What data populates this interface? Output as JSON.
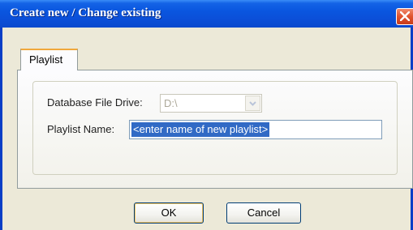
{
  "window": {
    "title": "Create new / Change existing"
  },
  "tabs": [
    {
      "label": "Playlist",
      "selected": true
    }
  ],
  "form": {
    "drive_label": "Database File Drive:",
    "drive_value": "D:\\",
    "name_label": "Playlist Name:",
    "name_value": "<enter name of new playlist>"
  },
  "buttons": {
    "ok_label": "OK",
    "cancel_label": "Cancel"
  },
  "colors": {
    "titlebar": "#0a56df",
    "close_button": "#e0512d",
    "selection": "#316ac5",
    "dialog_background": "#ece9d8"
  },
  "icons": {
    "close": "close-icon",
    "dropdown": "chevron-down-icon"
  }
}
